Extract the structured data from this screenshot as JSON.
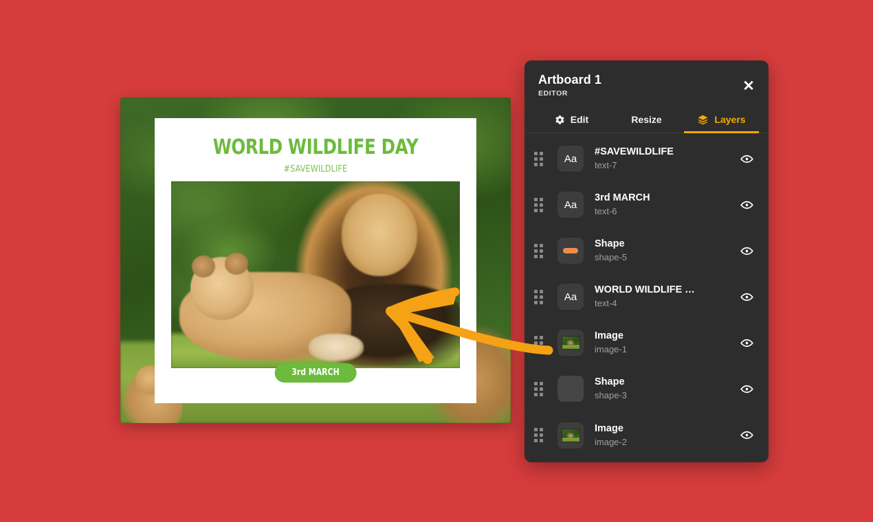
{
  "background": {
    "color": "#d63c3c"
  },
  "design": {
    "title": "WORLD WILDLIFE DAY",
    "subtitle": "#SAVEWILDLIFE",
    "date_badge": "3rd MARCH",
    "title_color": "#6cbb3c",
    "badge_color": "#6cbb3c",
    "card_color": "#ffffff",
    "photo_alt": "lion and cub resting on grass"
  },
  "panel": {
    "title": "Artboard 1",
    "subtitle": "EDITOR",
    "close_label": "✕",
    "accent_color": "#f5a800",
    "background_color": "#2d2d2d",
    "tabs": [
      {
        "label": "Edit",
        "icon": "gear-icon",
        "active": false
      },
      {
        "label": "Resize",
        "icon": "",
        "active": false
      },
      {
        "label": "Layers",
        "icon": "layers-icon",
        "active": true
      }
    ],
    "layers": [
      {
        "name": "#SAVEWILDLIFE",
        "id": "text-7",
        "thumb": "text",
        "thumb_label": "Aa",
        "visible": true
      },
      {
        "name": "3rd MARCH",
        "id": "text-6",
        "thumb": "text",
        "thumb_label": "Aa",
        "visible": true
      },
      {
        "name": "Shape",
        "id": "shape-5",
        "thumb": "pill",
        "thumb_label": "",
        "visible": true
      },
      {
        "name": "WORLD WILDLIFE …",
        "id": "text-4",
        "thumb": "text",
        "thumb_label": "Aa",
        "visible": true
      },
      {
        "name": "Image",
        "id": "image-1",
        "thumb": "image",
        "thumb_label": "",
        "visible": true
      },
      {
        "name": "Shape",
        "id": "shape-3",
        "thumb": "blank",
        "thumb_label": "",
        "visible": true
      },
      {
        "name": "Image",
        "id": "image-2",
        "thumb": "image",
        "thumb_label": "",
        "visible": true
      }
    ]
  },
  "annotation": {
    "type": "arrow",
    "color": "#f5a214",
    "points_from": "image-1 layer drag handle",
    "points_to": "lion photo on canvas"
  }
}
